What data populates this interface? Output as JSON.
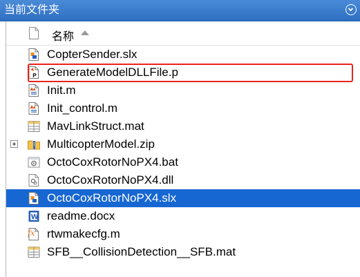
{
  "panel": {
    "title": "当前文件夹",
    "menu_icon": "circle-chevron-down-icon"
  },
  "header": {
    "name_column": "名称",
    "sort": "ascending"
  },
  "files": [
    {
      "name": "CopterSender.slx",
      "icon": "slx-file-icon",
      "selected": false,
      "expandable": false
    },
    {
      "name": "GenerateModelDLLFile.p",
      "icon": "p-file-icon",
      "selected": false,
      "expandable": false,
      "highlighted": true
    },
    {
      "name": "Init.m",
      "icon": "m-script-icon",
      "selected": false,
      "expandable": false
    },
    {
      "name": "Init_control.m",
      "icon": "m-script-icon",
      "selected": false,
      "expandable": false
    },
    {
      "name": "MavLinkStruct.mat",
      "icon": "mat-file-icon",
      "selected": false,
      "expandable": false
    },
    {
      "name": "MulticopterModel.zip",
      "icon": "zip-folder-icon",
      "selected": false,
      "expandable": true
    },
    {
      "name": "OctoCoxRotorNoPX4.bat",
      "icon": "bat-file-icon",
      "selected": false,
      "expandable": false
    },
    {
      "name": "OctoCoxRotorNoPX4.dll",
      "icon": "dll-file-icon",
      "selected": false,
      "expandable": false
    },
    {
      "name": "OctoCoxRotorNoPX4.slx",
      "icon": "slx-file-icon",
      "selected": true,
      "expandable": false
    },
    {
      "name": "readme.docx",
      "icon": "word-doc-icon",
      "selected": false,
      "expandable": false
    },
    {
      "name": "rtwmakecfg.m",
      "icon": "m-function-icon",
      "selected": false,
      "expandable": false
    },
    {
      "name": "SFB__CollisionDetection__SFB.mat",
      "icon": "mat-file-icon",
      "selected": false,
      "expandable": false
    }
  ],
  "colors": {
    "titlebar": "#2f6fc2",
    "selection": "#1767d3",
    "highlight_border": "#e8221e"
  }
}
